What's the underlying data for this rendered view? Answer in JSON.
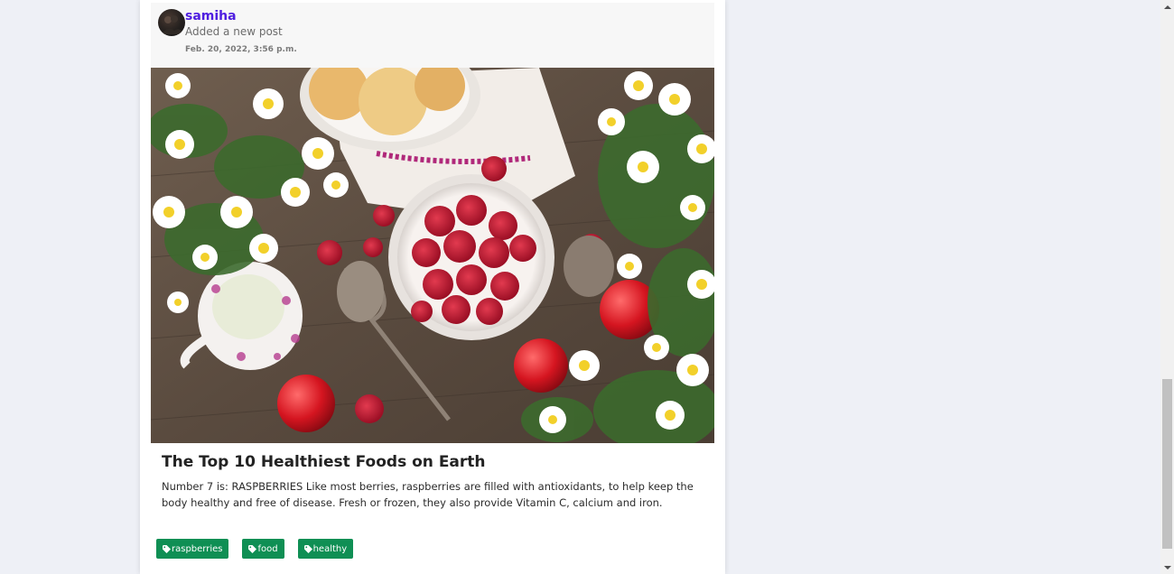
{
  "post": {
    "author": "samiha",
    "action": "Added a new post",
    "timestamp": "Feb. 20, 2022, 3:56 p.m.",
    "title": "The Top 10 Healthiest Foods on Earth",
    "body": "Number 7 is: RASPBERRIES Like most berries, raspberries are filled with antioxidants, to help keep the body healthy and free of disease. Fresh or frozen, they also provide Vitamin C, calcium and iron.",
    "tags": [
      "raspberries",
      "food",
      "healthy"
    ]
  },
  "colors": {
    "author": "#4f1ee0",
    "tag_background": "#0f8f54",
    "page_background": "#eef0f6"
  },
  "icons": {
    "tag": "tag-icon",
    "scroll_up": "chevron-up-icon",
    "scroll_down": "chevron-down-icon"
  }
}
